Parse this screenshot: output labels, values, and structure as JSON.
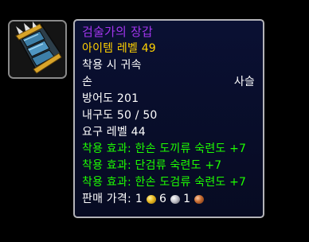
{
  "item": {
    "icon": "gauntlet-icon",
    "name": "검술가의 장갑",
    "item_level": "아이템 레벨 49",
    "binding": "착용 시 귀속",
    "slot": "손",
    "armor_type": "사슬",
    "armor": "방어도 201",
    "durability": "내구도 50 / 50",
    "required_level": "요구 레벨 44",
    "equip_effects": [
      "착용 효과: 한손 도끼류 숙련도 +7",
      "착용 효과: 단검류 숙련도 +7",
      "착용 효과: 한손 도검류 숙련도 +7"
    ],
    "sell_price": {
      "label": "판매 가격:",
      "gold": "1",
      "silver": "6",
      "copper": "1"
    }
  },
  "colors": {
    "epic_name": "#a335ee",
    "item_level": "#ffd100",
    "equip_effect": "#1eff00",
    "tooltip_bg": "#0a1033"
  }
}
